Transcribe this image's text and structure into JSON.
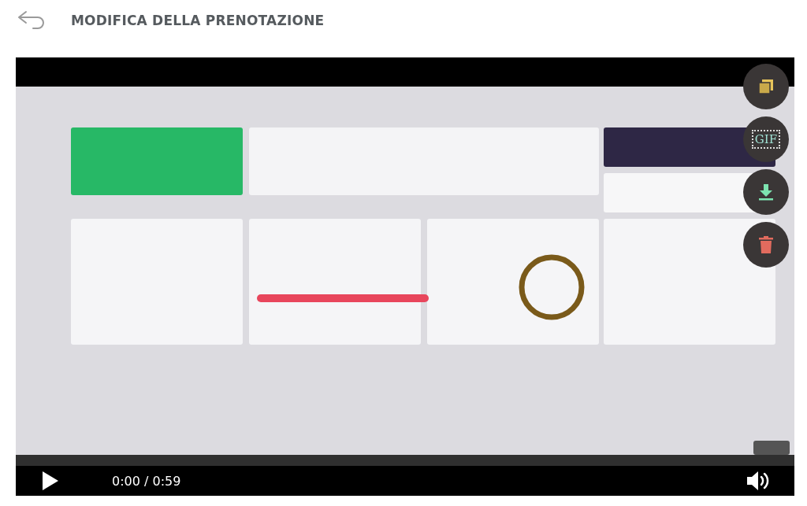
{
  "header": {
    "title": "MODIFICA DELLA PRENOTAZIONE"
  },
  "video": {
    "kind": "picture",
    "time": "0:00 / 0:59"
  },
  "actions": [
    {
      "kind": "copy"
    },
    {
      "kind": "gif",
      "label": "GIF"
    },
    {
      "kind": "download"
    },
    {
      "kind": "delete"
    }
  ]
}
